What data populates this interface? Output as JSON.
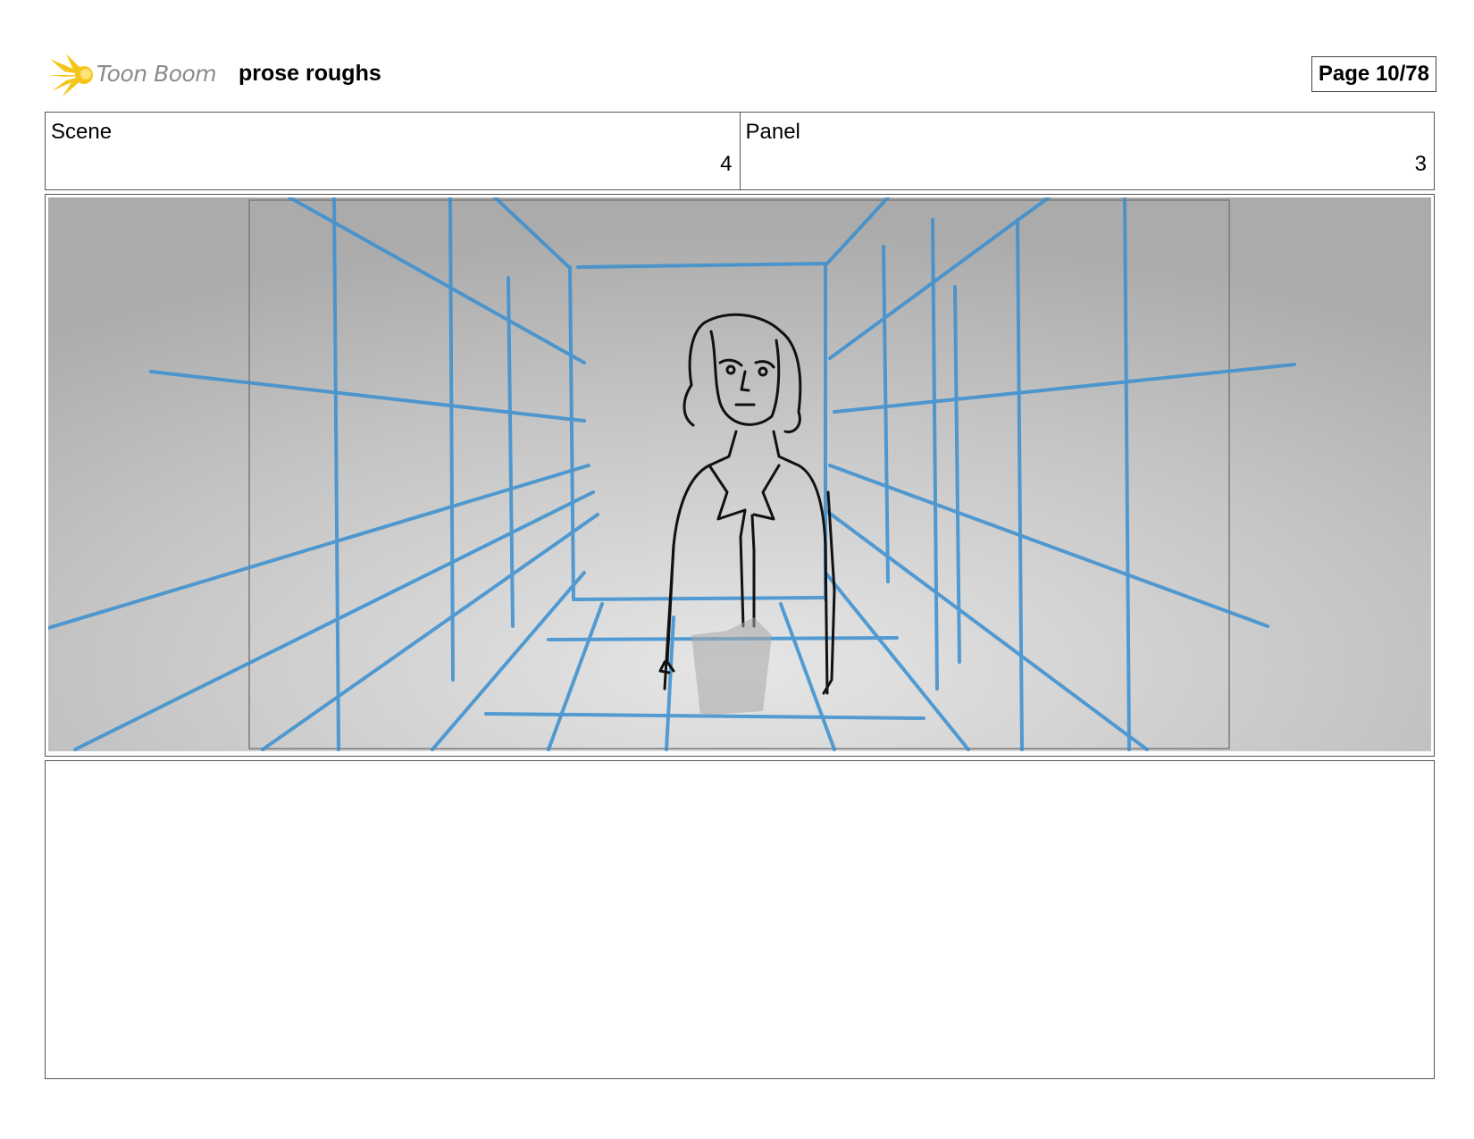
{
  "header": {
    "logo_text": "Toon Boom",
    "project_title": "prose roughs",
    "page_label": "Page 10/78"
  },
  "info": {
    "scene_label": "Scene",
    "scene_value": "4",
    "panel_label": "Panel",
    "panel_value": "3"
  },
  "colors": {
    "logo_star": "#f5c518",
    "guide_lines": "#3a8fd0",
    "sketch_ink": "#111111",
    "panel_bg": "#bdbdbd"
  }
}
